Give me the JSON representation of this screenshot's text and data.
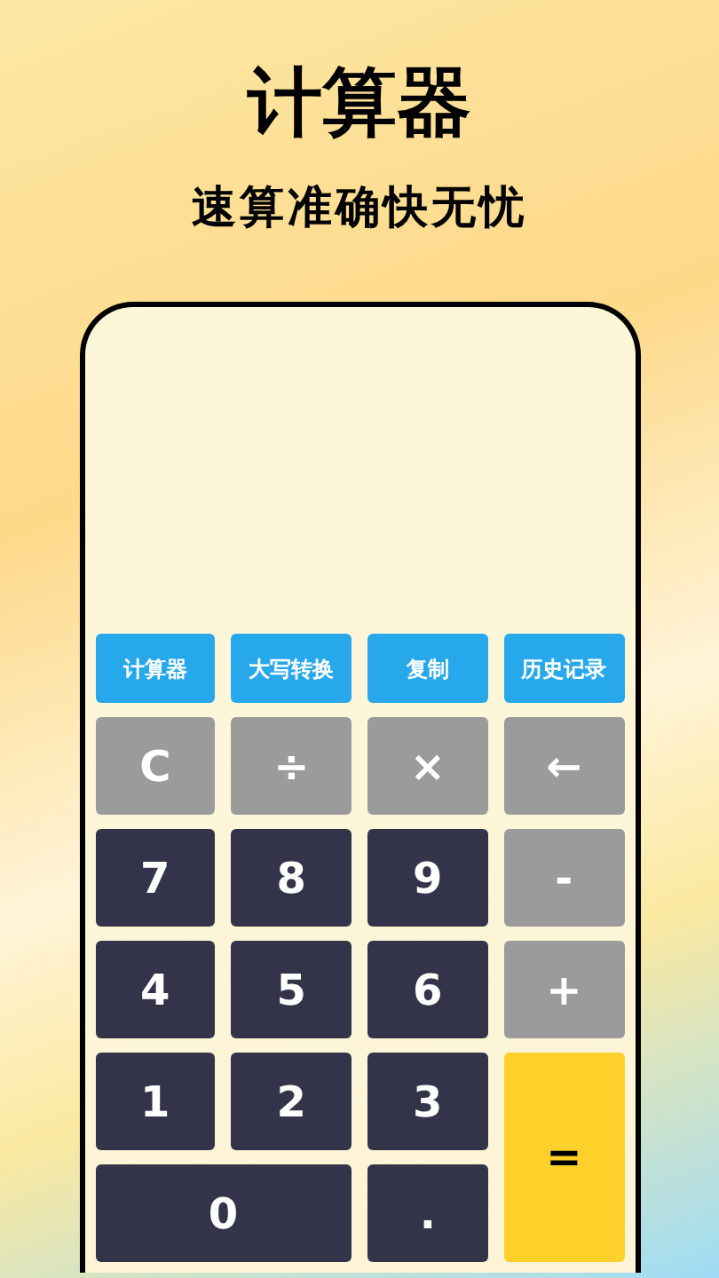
{
  "headline": "计算器",
  "tagline": "速算准确快无忧",
  "tool_tabs": [
    {
      "label": "计算器"
    },
    {
      "label": "大写转换"
    },
    {
      "label": "复制"
    },
    {
      "label": "历史记录"
    }
  ],
  "keys": [
    {
      "label": "C",
      "kind": "op"
    },
    {
      "label": "÷",
      "kind": "op"
    },
    {
      "label": "×",
      "kind": "op"
    },
    {
      "label": "←",
      "kind": "op"
    },
    {
      "label": "7",
      "kind": "digit"
    },
    {
      "label": "8",
      "kind": "digit"
    },
    {
      "label": "9",
      "kind": "digit"
    },
    {
      "label": "-",
      "kind": "op"
    },
    {
      "label": "4",
      "kind": "digit"
    },
    {
      "label": "5",
      "kind": "digit"
    },
    {
      "label": "6",
      "kind": "digit"
    },
    {
      "label": "+",
      "kind": "op"
    },
    {
      "label": "1",
      "kind": "digit"
    },
    {
      "label": "2",
      "kind": "digit"
    },
    {
      "label": "3",
      "kind": "digit"
    },
    {
      "label": "=",
      "kind": "equals"
    },
    {
      "label": "0",
      "kind": "zero"
    },
    {
      "label": ".",
      "kind": "digit"
    }
  ]
}
